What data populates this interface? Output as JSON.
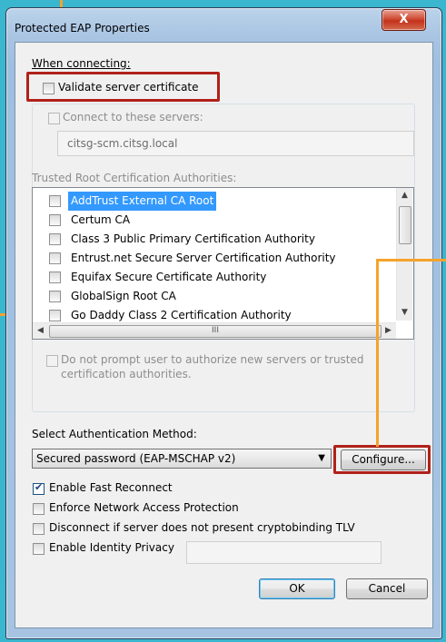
{
  "window": {
    "title": "Protected EAP Properties",
    "close_glyph": "X"
  },
  "connect": {
    "section_label": "When connecting:",
    "validate_label": "Validate server certificate",
    "validate_checked": false,
    "connect_servers_label": "Connect to these servers:",
    "connect_servers_checked": false,
    "servers_value": "citsg-scm.citsg.local",
    "trusted_label": "Trusted Root Certification Authorities:"
  },
  "ca_list": [
    {
      "label": "AddTrust External CA Root",
      "checked": false,
      "selected": true
    },
    {
      "label": "Certum CA",
      "checked": false,
      "selected": false
    },
    {
      "label": "Class 3 Public Primary Certification Authority",
      "checked": false,
      "selected": false
    },
    {
      "label": "Entrust.net Secure Server Certification Authority",
      "checked": false,
      "selected": false
    },
    {
      "label": "Equifax Secure Certificate Authority",
      "checked": false,
      "selected": false
    },
    {
      "label": "GlobalSign Root CA",
      "checked": false,
      "selected": false
    },
    {
      "label": "Go Daddy Class 2 Certification Authority",
      "checked": false,
      "selected": false
    }
  ],
  "scroll": {
    "hthumb_grip": "III"
  },
  "prompt": {
    "line1": "Do not prompt user to authorize new servers or trusted",
    "line2": "certification authorities.",
    "checked": false
  },
  "auth": {
    "label": "Select Authentication Method:",
    "method_value": "Secured password (EAP-MSCHAP v2)",
    "configure_label": "Configure..."
  },
  "options": [
    {
      "key": "fast_reconnect",
      "label": "Enable Fast Reconnect",
      "checked": true
    },
    {
      "key": "nap",
      "label": "Enforce Network Access Protection",
      "checked": false
    },
    {
      "key": "cryptobinding",
      "label": "Disconnect if server does not present cryptobinding TLV",
      "checked": false
    },
    {
      "key": "identity_privacy",
      "label": "Enable Identity Privacy",
      "checked": false
    }
  ],
  "identity_value": "",
  "buttons": {
    "ok": "OK",
    "cancel": "Cancel"
  },
  "colors": {
    "highlight_box": "#b0211a",
    "callout_line": "#f4a32b",
    "selection": "#3399ff",
    "background": "#3bb6cf"
  }
}
